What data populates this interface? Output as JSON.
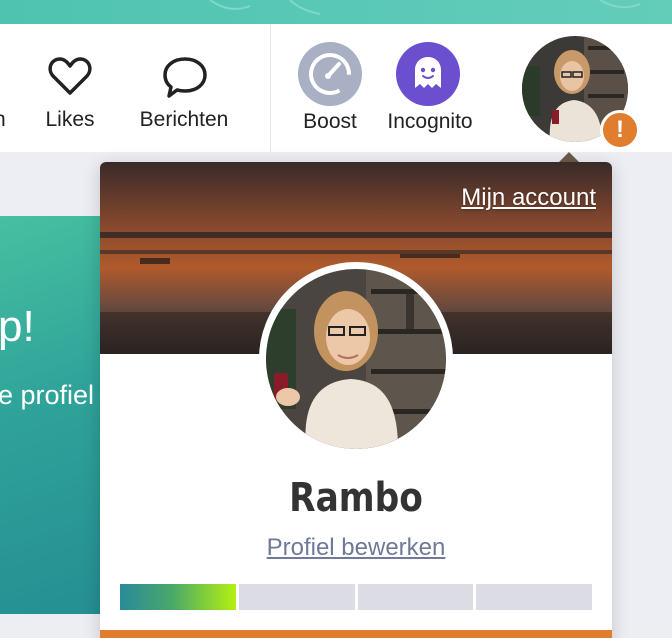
{
  "nav": {
    "cut_label": "n",
    "likes": {
      "label": "Likes",
      "icon": "heart-icon"
    },
    "messages": {
      "label": "Berichten",
      "icon": "speech-bubble-icon"
    },
    "boost": {
      "label": "Boost",
      "icon": "speedometer-icon",
      "color": "#a9b0c4"
    },
    "incognito": {
      "label": "Incognito",
      "icon": "ghost-icon",
      "color": "#6b4fcf"
    },
    "alert_badge": "!"
  },
  "promo": {
    "headline": "p!",
    "subtext": "e profiel"
  },
  "dropdown": {
    "account_link": "Mijn account",
    "name": "Rambo",
    "edit_profile": "Profiel bewerken",
    "completion_segments": 4,
    "completion_filled": 1,
    "accent_color": "#e07d2e"
  }
}
